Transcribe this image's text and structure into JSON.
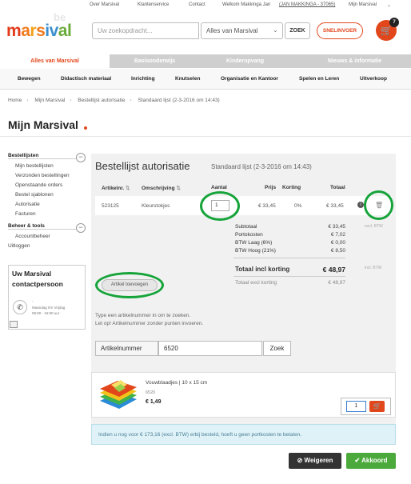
{
  "topbar": {
    "links": [
      "Over Marsival",
      "Klantenservice",
      "Contact"
    ],
    "welcome_prefix": "Welkom Makkinga Jan",
    "welcome_account": "(JAN MAKKINGA - 37065)",
    "account_menu": "Mijn Marsival"
  },
  "logo": {
    "letters": [
      "m",
      "a",
      "r",
      "s",
      "i",
      "v",
      "a",
      "l"
    ],
    "suffix": "be"
  },
  "header": {
    "search_placeholder": "Uw zoekopdracht...",
    "scope_value": "Alles van Marsival",
    "search_button": "ZOEK",
    "quick_order": "SNELINVOER",
    "cart_count": "7",
    "accent_color": "#e2461b"
  },
  "tabs": [
    {
      "label": "Alles van Marsival",
      "active": true
    },
    {
      "label": "Basisonderwijs",
      "active": false
    },
    {
      "label": "Kinderopvang",
      "active": false
    },
    {
      "label": "Nieuws & informatie",
      "active": false
    }
  ],
  "categories": [
    "Bewegen",
    "Didactisch materiaal",
    "Inrichting",
    "Knutselen",
    "Organisatie en Kantoor",
    "Spelen en Leren",
    "Uitverkoop"
  ],
  "breadcrumb": [
    "Home",
    "Mijn Marsival",
    "Bestellijst autorisatie",
    "Standaard lijst (2-3-2016 om 14:43)"
  ],
  "page_title": "Mijn Marsival",
  "sidebar": {
    "group1_title": "Bestellijsten",
    "group1_items": [
      "Mijn bestellijsten",
      "Verzonden bestellingen",
      "Openstaande orders",
      "Bestel sjablonen",
      "Autorisatie",
      "Facturen"
    ],
    "group2_title": "Beheer & tools",
    "group2_items": [
      "Accountbeheer"
    ],
    "logout": "Uitloggen",
    "contact_title": "Uw Marsival contactpersoon",
    "contact_name": "-",
    "contact_hours_days": "Maandag t/m Vrijdag",
    "contact_hours_time": "09:00 - 16:00 uur"
  },
  "panel": {
    "title": "Bestellijst autorisatie",
    "subtitle": "Standaard lijst (2-3-2016 om 14:43)",
    "columns": [
      "Artikelnr.",
      "Omschrijving",
      "Aantal",
      "Prijs",
      "Korting",
      "Totaal"
    ],
    "row": {
      "artikelnr": "523125",
      "omschrijving": "Kleurstokjes",
      "aantal": "1",
      "prijs": "€ 33,45",
      "korting": "0%",
      "totaal": "€ 33,45"
    },
    "summary": [
      {
        "label": "Subtotaal",
        "value": "€ 33,45",
        "note": "excl. BTW"
      },
      {
        "label": "Portokosten",
        "value": "€ 7,02",
        "note": ""
      },
      {
        "label": "BTW Laag (6%)",
        "value": "€ 0,00",
        "note": ""
      },
      {
        "label": "BTW Hoog (21%)",
        "value": "€ 8,50",
        "note": ""
      }
    ],
    "total_label": "Totaal incl korting",
    "total_value": "€ 48,97",
    "total_note": "incl. BTW",
    "total_excl_label": "Totaal excl korting",
    "total_excl_value": "€ 48,97",
    "add_article_button": "Artikel toevoegen",
    "hint_line1": "Type een artikelnummer in om te zoeken.",
    "hint_line2": "Let op! Artikelnummer zonder punten invoeren.",
    "article_label": "Artikelnummer",
    "article_value": "6520",
    "zoek_button": "Zoek"
  },
  "product": {
    "name": "Vouwblaadjes | 10 x 15 cm",
    "code": "6520",
    "price": "€ 1,49",
    "qty": "1"
  },
  "notice": "Indien u nog voor € 173,16 (excl. BTW) erbij besteld, hoeft u geen portkosten te betalen.",
  "actions": {
    "reject": "Weigeren",
    "accept": "Akkoord"
  },
  "colors": {
    "accent": "#e2461b",
    "highlight": "#16a43a",
    "accept": "#4caa3c",
    "notice_bg": "#dff2f8"
  }
}
